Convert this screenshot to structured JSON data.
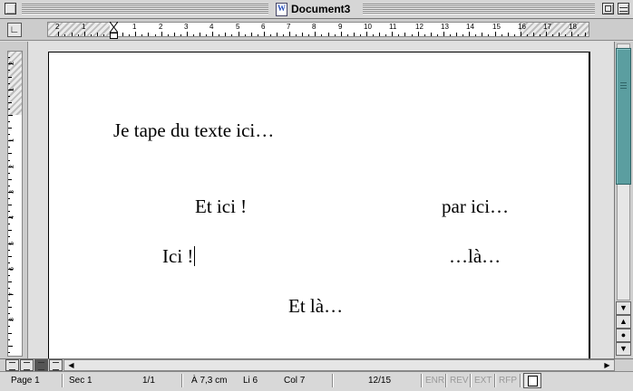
{
  "window": {
    "title": "Document3"
  },
  "ruler": {
    "numbers": [
      "2",
      "1",
      "1",
      "2",
      "3",
      "4",
      "5",
      "6",
      "7",
      "8",
      "9",
      "10",
      "11",
      "12",
      "13",
      "14",
      "15",
      "16",
      "17",
      "18"
    ]
  },
  "vruler": {
    "numbers": [
      "2",
      "1",
      "1",
      "2",
      "3",
      "4",
      "5",
      "6",
      "7",
      "8"
    ]
  },
  "document": {
    "lines": [
      {
        "text": "Je tape du texte ici…"
      },
      {
        "text": "Et ici !"
      },
      {
        "text": "par ici…"
      },
      {
        "text": "Ici !"
      },
      {
        "text": "…là…"
      },
      {
        "text": "Et là…"
      }
    ]
  },
  "icons": {
    "close": "close-box-icon",
    "zoom": "zoom-box-icon",
    "collapse": "collapse-box-icon",
    "doc": "word-document-icon",
    "tab": "left-tab-icon"
  },
  "scroll": {
    "up": "▲",
    "down": "▼",
    "prev_page": "⇞",
    "browse": "●",
    "next_page": "⇟",
    "left": "◀",
    "right": "▶"
  },
  "status": {
    "page": "Page 1",
    "section": "Sec 1",
    "pages": "1/1",
    "at": "À 7,3 cm",
    "line": "Li 6",
    "col": "Col 7",
    "words": "12/15",
    "enr": "ENR",
    "rev": "REV",
    "ext": "EXT",
    "rfp": "RFP"
  },
  "colors": {
    "scroll_thumb": "#5b9ea0",
    "chrome": "#d6d6d6"
  }
}
